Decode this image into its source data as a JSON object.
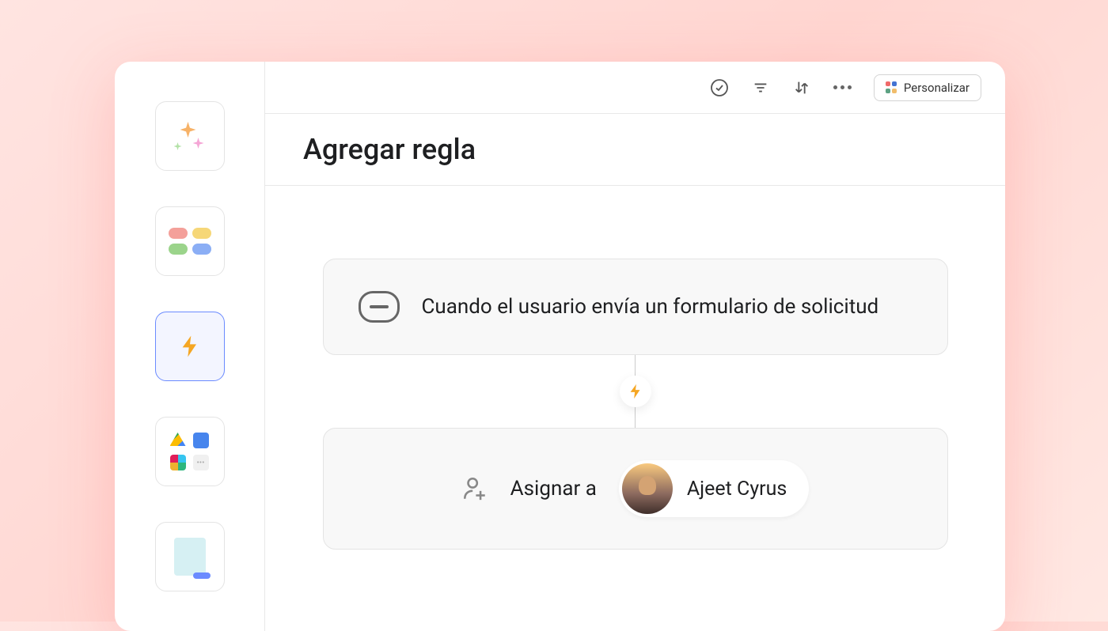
{
  "header": {
    "customize_label": "Personalizar"
  },
  "page": {
    "title": "Agregar regla"
  },
  "sidebar": {
    "items": [
      {
        "id": "ai-sparkles",
        "active": false
      },
      {
        "id": "fields-colors",
        "active": false
      },
      {
        "id": "automation-rules",
        "active": true
      },
      {
        "id": "app-integrations",
        "active": false
      },
      {
        "id": "templates-docs",
        "active": false
      }
    ]
  },
  "rule": {
    "trigger": {
      "icon": "form-icon",
      "text": "Cuando el usuario envía un formulario de solicitud"
    },
    "action": {
      "icon": "assign-person-icon",
      "label": "Asignar a",
      "assignee_name": "Ajeet Cyrus"
    }
  },
  "colors": {
    "accent_orange": "#f5a623",
    "selected_border": "#6b8bff",
    "pill_red": "#f4a09a",
    "pill_yellow": "#f6d778",
    "pill_green": "#9bd48b",
    "pill_blue": "#8baef5"
  }
}
